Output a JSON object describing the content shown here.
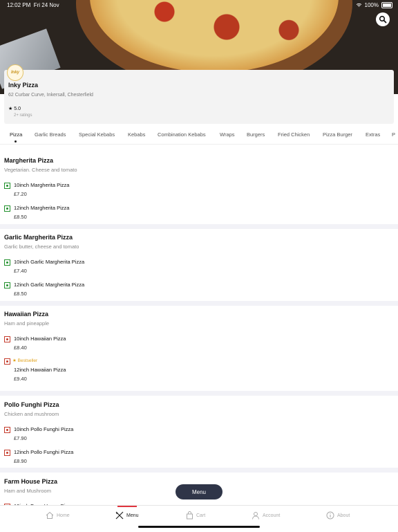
{
  "status": {
    "time": "12:02 PM",
    "date": "Fri 24 Nov",
    "battery": "100%"
  },
  "restaurant": {
    "logo_text": "Inky",
    "name": "Inky Pizza",
    "address": "62 Curbar Curve, Inkersall, Chesterfield",
    "rating": "5.0",
    "rating_count": "2+ ratings"
  },
  "tabs": [
    "Pizza",
    "Garlic Breads",
    "Special Kebabs",
    "Kebabs",
    "Combination Kebabs",
    "Wraps",
    "Burgers",
    "Fried Chicken",
    "Pizza Burger",
    "Extras",
    "P"
  ],
  "sections": [
    {
      "title": "Margherita Pizza",
      "description": "Vegetarian. Cheese and tomato",
      "items": [
        {
          "name": "10inch Margherita Pizza",
          "price": "£7.20",
          "veg": true
        },
        {
          "name": "12inch Margherita Pizza",
          "price": "£8.50",
          "veg": true
        }
      ]
    },
    {
      "title": "Garlic Margherita Pizza",
      "description": "Garlic butter, cheese and tomato",
      "items": [
        {
          "name": "10inch Garlic Margherita Pizza",
          "price": "£7.40",
          "veg": true
        },
        {
          "name": "12inch Garlic Margherita Pizza",
          "price": "£8.50",
          "veg": true
        }
      ]
    },
    {
      "title": "Hawaiian Pizza",
      "description": "Ham and pineapple",
      "items": [
        {
          "name": "10inch Hawaiian Pizza",
          "price": "£8.40",
          "veg": false
        },
        {
          "name": "12inch Hawaiian Pizza",
          "price": "£9.40",
          "veg": false,
          "badge": "Bestseller"
        }
      ]
    },
    {
      "title": "Pollo Funghi Pizza",
      "description": "Chicken and mushroom",
      "items": [
        {
          "name": "10inch Pollo Funghi Pizza",
          "price": "£7.90",
          "veg": false
        },
        {
          "name": "12inch Pollo Funghi Pizza",
          "price": "£8.90",
          "veg": false
        }
      ]
    },
    {
      "title": "Farm House Pizza",
      "description": "Ham and Mushroom",
      "items": [
        {
          "name": "10inch Farm House Pizza",
          "price": "",
          "veg": false
        }
      ]
    }
  ],
  "fab_label": "Menu",
  "nav": [
    "Home",
    "Menu",
    "Cart",
    "Account",
    "About"
  ],
  "colors": {
    "accent": "#e0353e",
    "fab": "#2f3548",
    "veg": "#1f8f2a",
    "nonveg": "#c43b2b",
    "bestseller": "#e0a21a"
  }
}
